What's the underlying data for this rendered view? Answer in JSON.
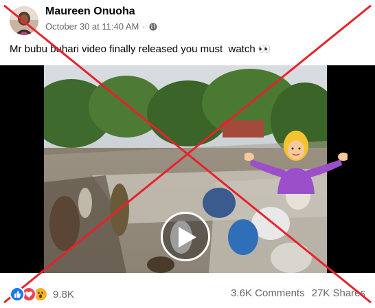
{
  "post": {
    "author": "Maureen Onuoha",
    "timestamp": "October 30 at 11:40 AM",
    "separator": "·",
    "privacy_icon": "globe-icon",
    "text": "Mr bubu buhari video finally released you must  watch 👀"
  },
  "video": {
    "play_icon": "play-icon",
    "overlay_emoji": "woman-shrugging"
  },
  "footer": {
    "reaction_icons": [
      "like-icon",
      "love-icon",
      "wow-icon"
    ],
    "reaction_count": "9.8K",
    "comments": "3.6K Comments",
    "shares": "27K Shares"
  },
  "colors": {
    "cross": "#e8212a",
    "like": "#1877f2",
    "love": "#f33e58",
    "wow": "#f7b125",
    "meta_text": "#65676b"
  }
}
